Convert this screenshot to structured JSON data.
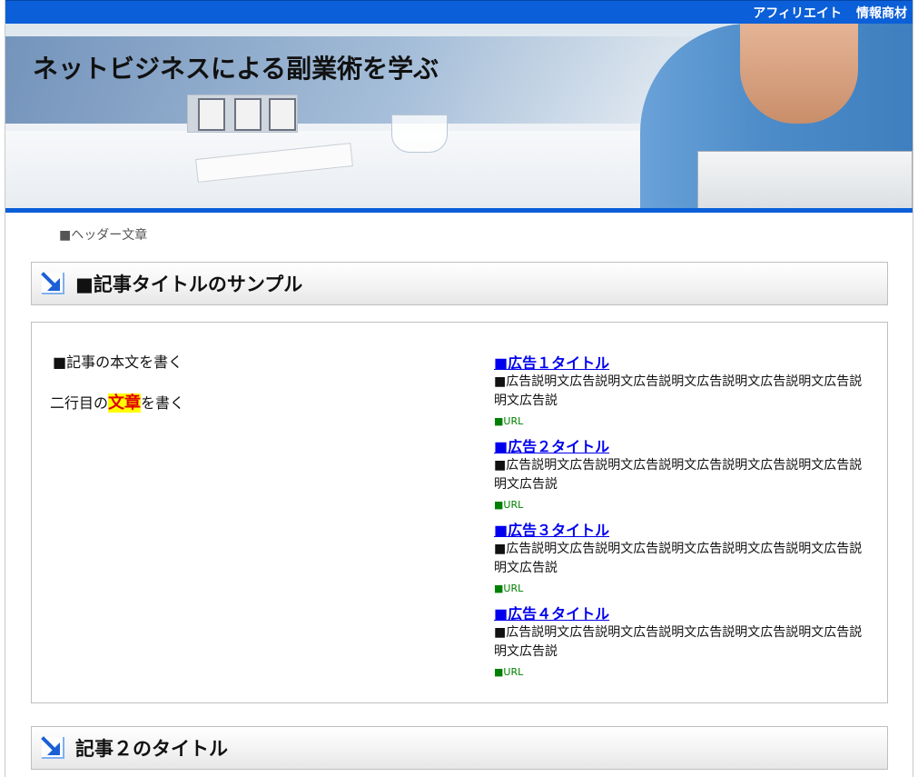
{
  "topbar": {
    "links": [
      "アフィリエイト",
      "情報商材"
    ]
  },
  "header": {
    "site_title": "ネットビジネスによる副業術を学ぶ",
    "header_text": "■ヘッダー文章"
  },
  "article1": {
    "title": "■記事タイトルのサンプル",
    "body_line1": "■記事の本文を書く",
    "body_line2_before": "二行目の",
    "body_line2_highlight": "文章",
    "body_line2_after": "を書く"
  },
  "ads": [
    {
      "title": "■広告１タイトル",
      "desc": "■広告説明文広告説明文広告説明文広告説明文広告説明文広告説明文広告説",
      "url": "■URL"
    },
    {
      "title": "■広告２タイトル",
      "desc": "■広告説明文広告説明文広告説明文広告説明文広告説明文広告説明文広告説",
      "url": "■URL"
    },
    {
      "title": "■広告３タイトル",
      "desc": "■広告説明文広告説明文広告説明文広告説明文広告説明文広告説明文広告説",
      "url": "■URL"
    },
    {
      "title": "■広告４タイトル",
      "desc": "■広告説明文広告説明文広告説明文広告説明文広告説明文広告説明文広告説",
      "url": "■URL"
    }
  ],
  "article2": {
    "title": "記事２のタイトル"
  },
  "colors": {
    "accent_blue": "#0b5fd8",
    "link_blue": "#0000ee",
    "url_green": "#008000",
    "highlight_bg": "#ffff00",
    "highlight_text": "#e00000"
  },
  "icons": {
    "section_arrow": "arrow-down-right-icon"
  }
}
